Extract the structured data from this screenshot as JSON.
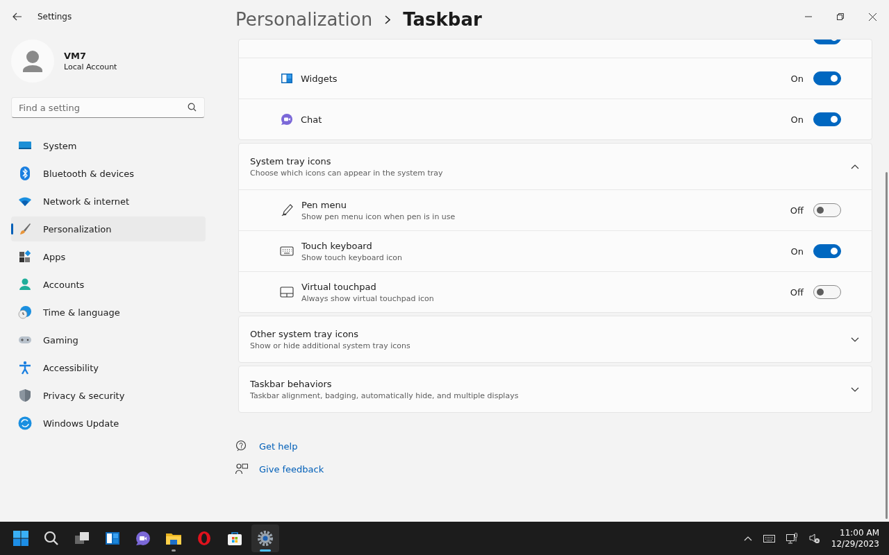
{
  "window": {
    "title": "Settings"
  },
  "account": {
    "name": "VM7",
    "type": "Local Account"
  },
  "search": {
    "placeholder": "Find a setting"
  },
  "sidebar": {
    "items": [
      {
        "label": "System",
        "kind": "system",
        "selected": false
      },
      {
        "label": "Bluetooth & devices",
        "kind": "bluetooth",
        "selected": false
      },
      {
        "label": "Network & internet",
        "kind": "network",
        "selected": false
      },
      {
        "label": "Personalization",
        "kind": "brush",
        "selected": true
      },
      {
        "label": "Apps",
        "kind": "apps",
        "selected": false
      },
      {
        "label": "Accounts",
        "kind": "accounts",
        "selected": false
      },
      {
        "label": "Time & language",
        "kind": "time",
        "selected": false
      },
      {
        "label": "Gaming",
        "kind": "gaming",
        "selected": false
      },
      {
        "label": "Accessibility",
        "kind": "accessibility",
        "selected": false
      },
      {
        "label": "Privacy & security",
        "kind": "privacy",
        "selected": false
      },
      {
        "label": "Windows Update",
        "kind": "update",
        "selected": false
      }
    ]
  },
  "breadcrumb": {
    "parent": "Personalization",
    "current": "Taskbar"
  },
  "taskbar_items": {
    "partial_row": {
      "on": true
    },
    "rows": [
      {
        "label": "Widgets",
        "kind": "widgets",
        "state": "On",
        "on": true
      },
      {
        "label": "Chat",
        "kind": "chat",
        "state": "On",
        "on": true
      }
    ]
  },
  "system_tray_icons": {
    "title": "System tray icons",
    "subtitle": "Choose which icons can appear in the system tray",
    "expanded": true,
    "rows": [
      {
        "label": "Pen menu",
        "description": "Show pen menu icon when pen is in use",
        "kind": "pen",
        "state": "Off",
        "on": false
      },
      {
        "label": "Touch keyboard",
        "description": "Show touch keyboard icon",
        "kind": "keyboard",
        "state": "On",
        "on": true
      },
      {
        "label": "Virtual touchpad",
        "description": "Always show virtual touchpad icon",
        "kind": "touchpad",
        "state": "Off",
        "on": false
      }
    ]
  },
  "sections": [
    {
      "title": "Other system tray icons",
      "subtitle": "Show or hide additional system tray icons",
      "expanded": false
    },
    {
      "title": "Taskbar behaviors",
      "subtitle": "Taskbar alignment, badging, automatically hide, and multiple displays",
      "expanded": false
    }
  ],
  "links": [
    {
      "label": "Get help",
      "kind": "help"
    },
    {
      "label": "Give feedback",
      "kind": "feedback"
    }
  ],
  "taskbar": {
    "apps": [
      {
        "kind": "start",
        "running": false,
        "selected": false
      },
      {
        "kind": "search",
        "running": false,
        "selected": false
      },
      {
        "kind": "taskview",
        "running": false,
        "selected": false
      },
      {
        "kind": "widgets",
        "running": false,
        "selected": false
      },
      {
        "kind": "chat",
        "running": false,
        "selected": false
      },
      {
        "kind": "folder",
        "running": true,
        "selected": false
      },
      {
        "kind": "browser",
        "running": false,
        "selected": false
      },
      {
        "kind": "store",
        "running": false,
        "selected": false
      },
      {
        "kind": "settings",
        "running": true,
        "selected": true
      }
    ],
    "tray": {
      "time": "11:00 AM",
      "date": "12/29/2023"
    }
  }
}
